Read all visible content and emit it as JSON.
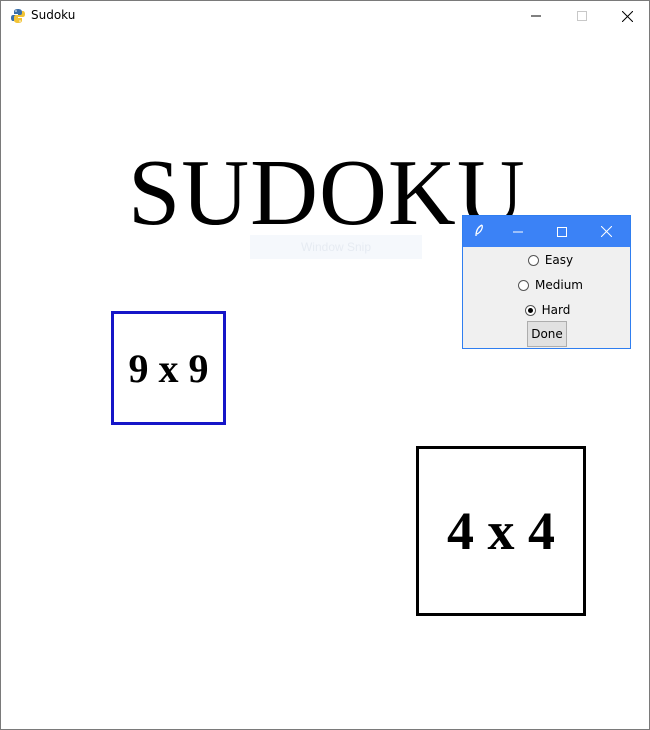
{
  "window": {
    "title": "Sudoku",
    "icon": "python-snake-icon"
  },
  "main": {
    "title": "SUDOKU",
    "ghost_text": "Window Snip",
    "grid_options": [
      {
        "label": "9 x 9",
        "border_color": "#1515c8",
        "selected": true
      },
      {
        "label": "4 x 4",
        "border_color": "#000000",
        "selected": false
      }
    ]
  },
  "dialog": {
    "icon": "feather-icon",
    "titlebar_color": "#3b82f6",
    "options": [
      {
        "label": "Easy",
        "checked": false
      },
      {
        "label": "Medium",
        "checked": false
      },
      {
        "label": "Hard",
        "checked": true
      }
    ],
    "done_label": "Done"
  }
}
